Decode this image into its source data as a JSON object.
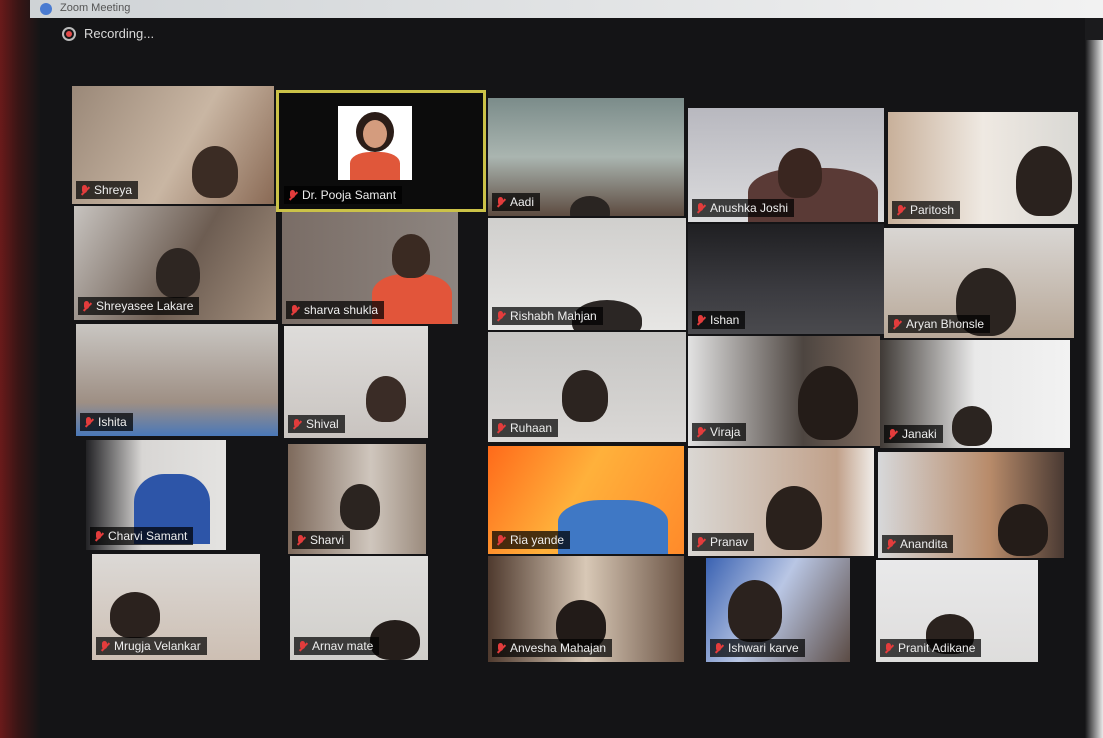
{
  "window": {
    "title": "Zoom Meeting"
  },
  "recording": {
    "label": "Recording..."
  },
  "participants": [
    {
      "name": "Shreya"
    },
    {
      "name": "Dr. Pooja Samant"
    },
    {
      "name": "Aadi"
    },
    {
      "name": "Anushka Joshi"
    },
    {
      "name": "Paritosh"
    },
    {
      "name": "Shreyasee Lakare"
    },
    {
      "name": "sharva shukla"
    },
    {
      "name": "Rishabh Mahjan"
    },
    {
      "name": "Ishan"
    },
    {
      "name": "Aryan Bhonsle"
    },
    {
      "name": "Ishita"
    },
    {
      "name": "Shival"
    },
    {
      "name": "Ruhaan"
    },
    {
      "name": "Viraja"
    },
    {
      "name": "Janaki"
    },
    {
      "name": "Charvi Samant"
    },
    {
      "name": "Sharvi"
    },
    {
      "name": "Ria yande"
    },
    {
      "name": "Pranav"
    },
    {
      "name": "Anandita"
    },
    {
      "name": "Mrugja Velankar"
    },
    {
      "name": "Arnav mate"
    },
    {
      "name": "Anvesha Mahajan"
    },
    {
      "name": "Ishwari karve"
    },
    {
      "name": "Pranit Adikane"
    }
  ]
}
